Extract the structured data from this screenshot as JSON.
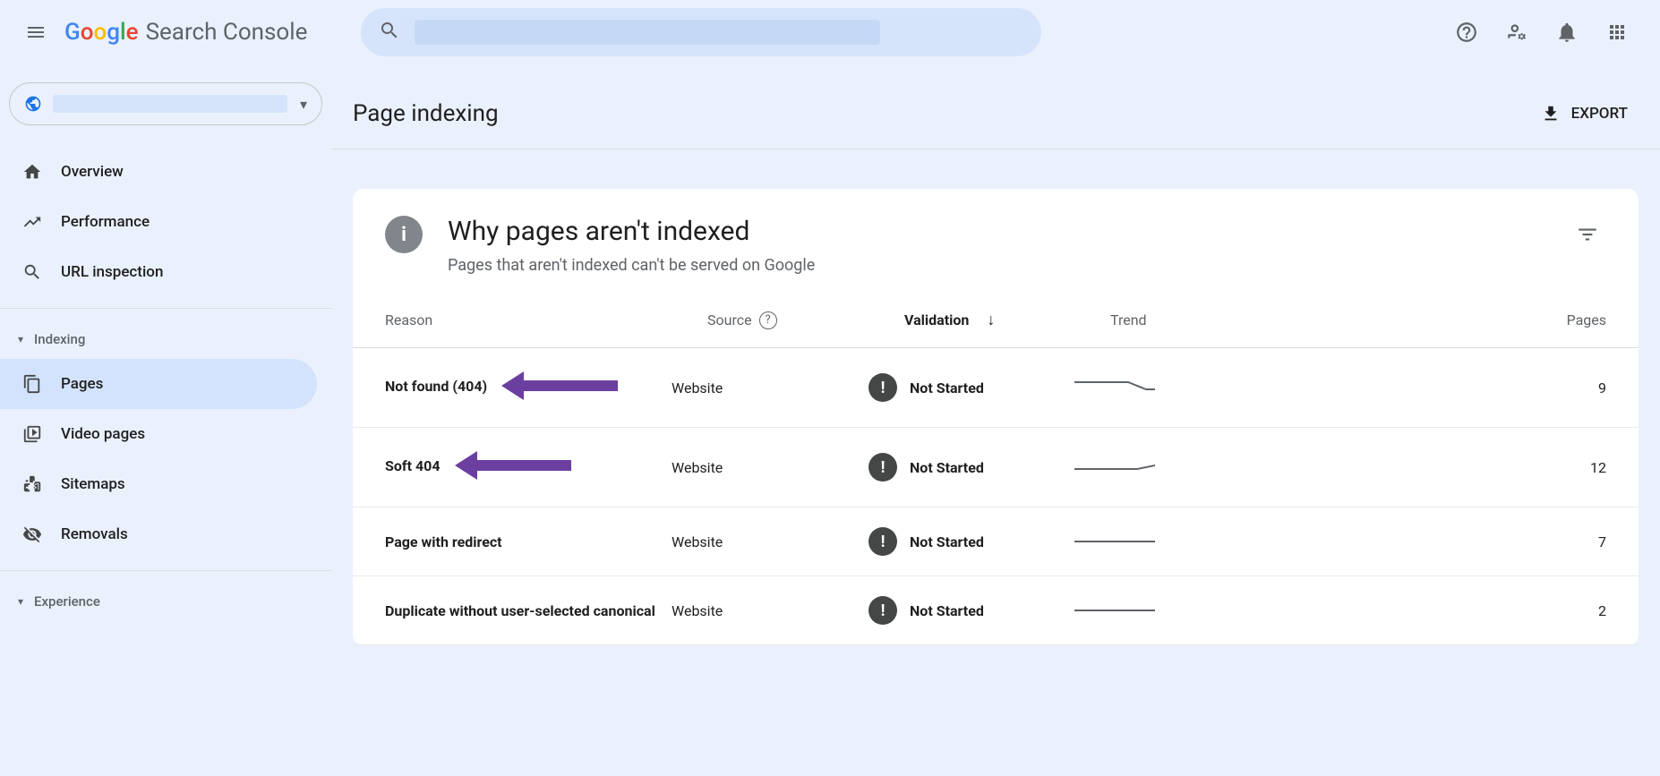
{
  "header": {
    "product_name": "Search Console"
  },
  "sidebar": {
    "items_main": [
      {
        "label": "Overview"
      },
      {
        "label": "Performance"
      },
      {
        "label": "URL inspection"
      }
    ],
    "sections": [
      {
        "name": "Indexing",
        "items": [
          {
            "label": "Pages",
            "active": true
          },
          {
            "label": "Video pages"
          },
          {
            "label": "Sitemaps"
          },
          {
            "label": "Removals"
          }
        ]
      },
      {
        "name": "Experience",
        "items": []
      }
    ]
  },
  "page": {
    "title": "Page indexing",
    "export": "EXPORT"
  },
  "card": {
    "title": "Why pages aren't indexed",
    "subtitle": "Pages that aren't indexed can't be served on Google"
  },
  "table": {
    "columns": {
      "reason": "Reason",
      "source": "Source",
      "validation": "Validation",
      "trend": "Trend",
      "pages": "Pages"
    },
    "rows": [
      {
        "reason": "Not found (404)",
        "source": "Website",
        "validation": "Not Started",
        "pages": "9"
      },
      {
        "reason": "Soft 404",
        "source": "Website",
        "validation": "Not Started",
        "pages": "12"
      },
      {
        "reason": "Page with redirect",
        "source": "Website",
        "validation": "Not Started",
        "pages": "7"
      },
      {
        "reason": "Duplicate without user-selected canonical",
        "source": "Website",
        "validation": "Not Started",
        "pages": "2"
      }
    ]
  }
}
